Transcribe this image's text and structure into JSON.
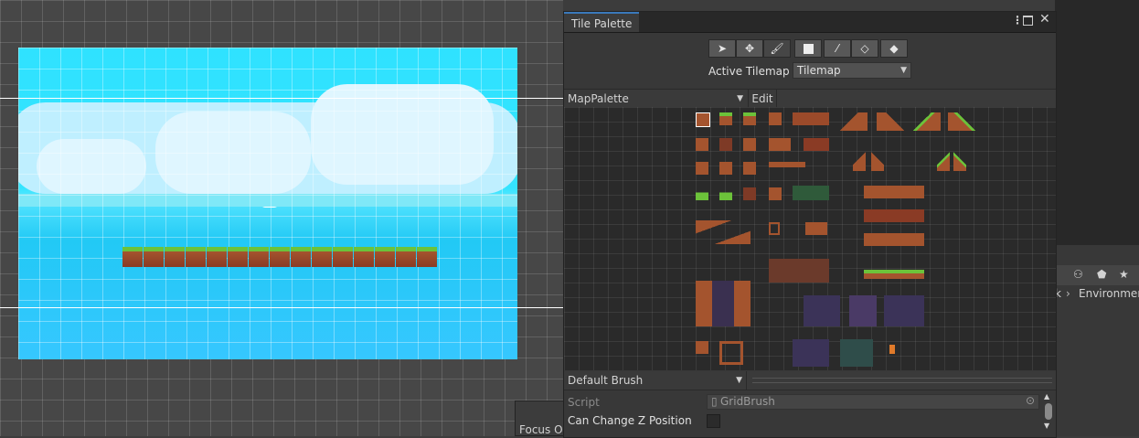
{
  "window": {
    "tab_title": "Tile Palette",
    "menu_icon": "kebab-menu-icon",
    "maximize_icon": "maximize-icon",
    "close_icon": "close-icon"
  },
  "toolbar": {
    "tools": [
      "select-icon",
      "move-icon",
      "paint-brush-icon",
      "box-fill-icon",
      "picker-icon",
      "eraser-icon",
      "fill-icon"
    ],
    "active_tool": "paint-brush-icon"
  },
  "active_tilemap": {
    "label": "Active Tilemap",
    "value": "Tilemap"
  },
  "palette": {
    "selected": "MapPalette",
    "edit_label": "Edit"
  },
  "brush": {
    "selected": "Default Brush",
    "script_label": "Script",
    "script_value": "GridBrush",
    "z_label": "Can Change Z Position",
    "z_checked": false
  },
  "background": {
    "focus_label": "Focus On",
    "breadcrumb_sep": "k",
    "breadcrumb_item": "Environment"
  },
  "colors": {
    "sky": "#34e4ff",
    "ocean": "#36c7ff",
    "grass": "#6cc23a",
    "dirt": "#a4542e",
    "accent": "#3a79bb"
  }
}
